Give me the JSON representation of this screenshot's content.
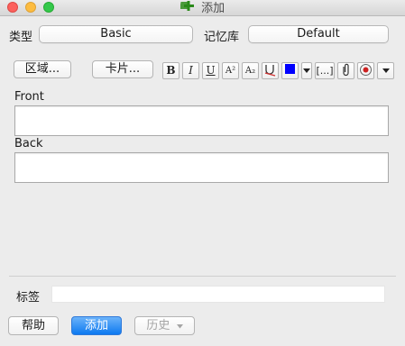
{
  "window": {
    "title": "添加"
  },
  "top": {
    "type_label": "类型",
    "type_value": "Basic",
    "deck_label": "记忆库",
    "deck_value": "Default"
  },
  "toolbar": {
    "fields_button": "区域...",
    "cards_button": "卡片...",
    "bold": "B",
    "italic": "I",
    "underline": "U",
    "superscript": "A²",
    "subscript": "A₂",
    "cloze": "[...]",
    "text_color": "#0000ff",
    "record_color": "#cc2020",
    "link_color": "#e05050"
  },
  "fields": [
    {
      "label": "Front"
    },
    {
      "label": "Back"
    }
  ],
  "tags": {
    "label": "标签"
  },
  "buttons": {
    "help": "帮助",
    "add": "添加",
    "history": "历史"
  }
}
